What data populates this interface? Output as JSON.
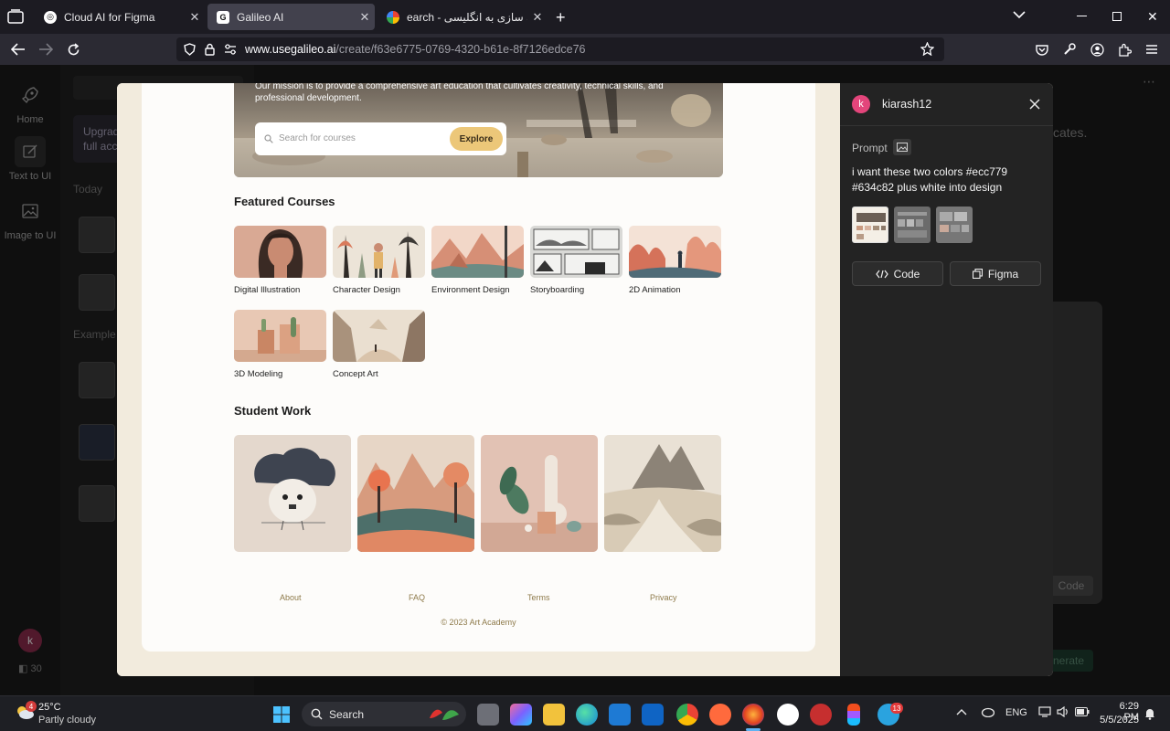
{
  "browser": {
    "tabs": [
      {
        "label": "Cloud AI for Figma",
        "active": false
      },
      {
        "label": "Galileo AI",
        "active": true
      },
      {
        "label": "earch - مجسمه سازی به انگلیسی",
        "active": false
      }
    ],
    "url_host": "www.usegalileo.ai",
    "url_path": "/create/f63e6775-0769-4320-b61e-8f7126edce76"
  },
  "app": {
    "rail": [
      {
        "label": "Home"
      },
      {
        "label": "Text to UI"
      },
      {
        "label": "Image to UI"
      }
    ],
    "upgrade_text_1": "Upgrad",
    "upgrade_text_2": "full acc",
    "today_label": "Today",
    "examples_label": "Example",
    "user_initial": "k",
    "credits": "30",
    "right_text": "cates.",
    "right_code_btn": "Code",
    "right_generate_btn": "nerate",
    "right_more": "⋯"
  },
  "preview": {
    "hero_text": "Our mission is to provide a comprehensive art education that cultivates creativity, technical skills, and professional development.",
    "search_placeholder": "Search for courses",
    "explore_label": "Explore",
    "featured_heading": "Featured Courses",
    "courses": [
      "Digital Illustration",
      "Character Design",
      "Environment Design",
      "Storyboarding",
      "2D Animation",
      "3D Modeling",
      "Concept Art"
    ],
    "student_heading": "Student Work",
    "footer_links": [
      "About",
      "FAQ",
      "Terms",
      "Privacy"
    ],
    "copyright": "© 2023 Art Academy"
  },
  "panel": {
    "avatar_initial": "k",
    "username": "kiarash12",
    "prompt_label": "Prompt",
    "prompt_text": "i want these two colors  #ecc779  #634c82  plus white into design",
    "code_label": "Code",
    "figma_label": "Figma"
  },
  "colors": {
    "accent_yellow": "#ecc779",
    "accent_purple": "#634c82",
    "avatar_pink": "#e3457b"
  },
  "taskbar": {
    "temperature": "25°C",
    "weather": "Partly cloudy",
    "weather_badge": "4",
    "search_label": "Search",
    "lang": "ENG",
    "time": "6:29 PM",
    "date": "5/5/2025",
    "telegram_badge": "13"
  }
}
